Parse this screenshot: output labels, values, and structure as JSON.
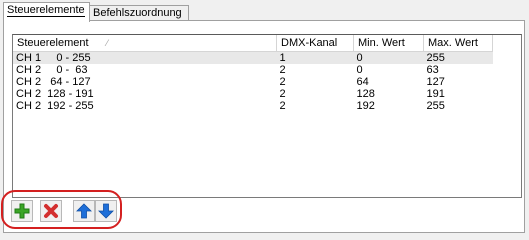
{
  "tabs": [
    {
      "label": "Steuerelemente",
      "active": true
    },
    {
      "label": "Befehlszuordnung",
      "active": false
    }
  ],
  "table": {
    "columns": [
      "Steuerelement",
      "DMX-Kanal",
      "Min. Wert",
      "Max. Wert"
    ],
    "rows": [
      {
        "control": "CH 1     0 - 255",
        "channel": "1",
        "min": "0",
        "max": "255"
      },
      {
        "control": "CH 2     0 -  63",
        "channel": "2",
        "min": "0",
        "max": "63"
      },
      {
        "control": "CH 2   64 - 127",
        "channel": "2",
        "min": "64",
        "max": "127"
      },
      {
        "control": "CH 2  128 - 191",
        "channel": "2",
        "min": "128",
        "max": "191"
      },
      {
        "control": "CH 2  192 - 255",
        "channel": "2",
        "min": "192",
        "max": "255"
      }
    ]
  },
  "toolbar": {
    "icons": [
      "add-icon",
      "delete-icon",
      "move-up-icon",
      "move-down-icon"
    ],
    "colors": {
      "add": "#3aa526",
      "delete": "#d32f2f",
      "arrows": "#1e6fd9",
      "highlight": "#d42020"
    }
  }
}
